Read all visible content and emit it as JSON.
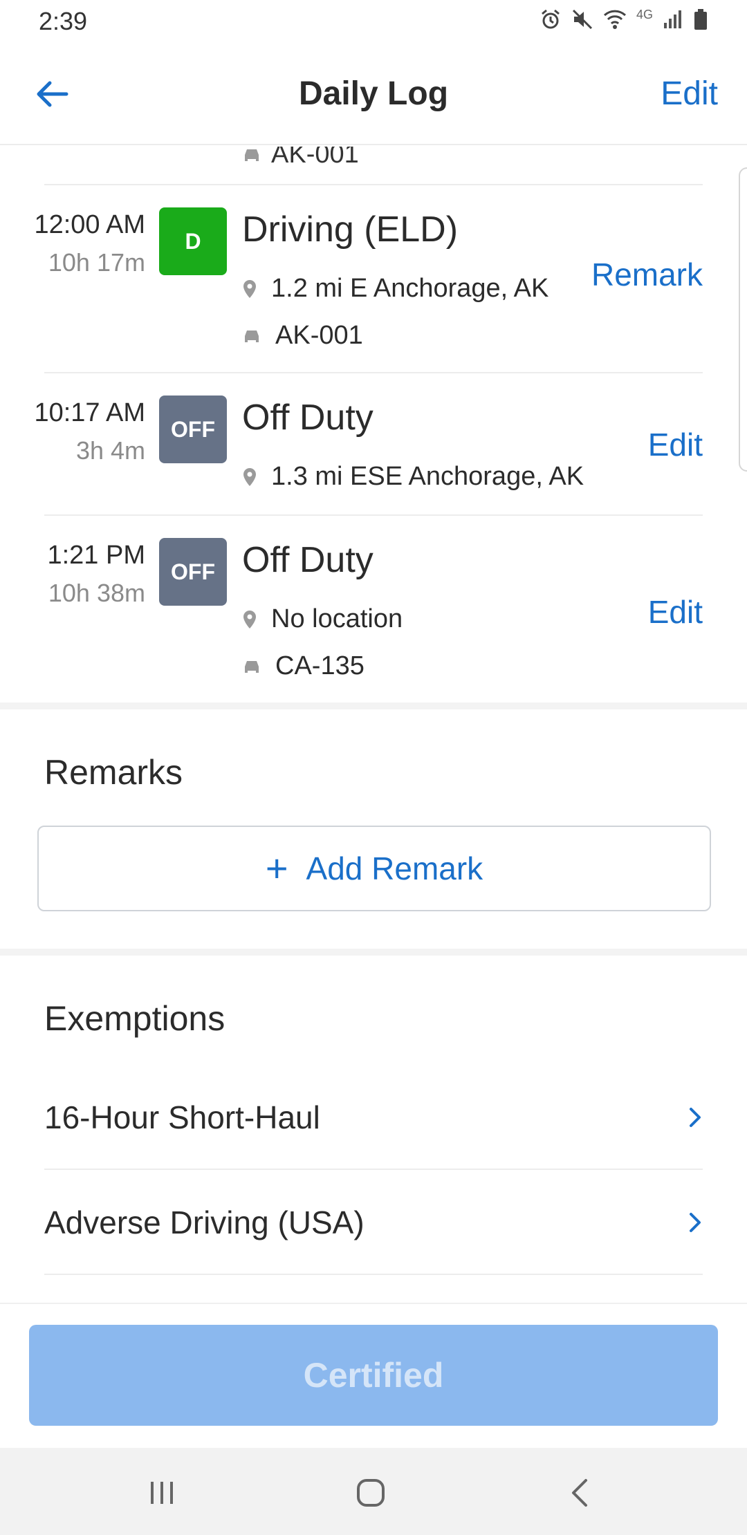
{
  "status_bar": {
    "time": "2:39",
    "network": "4G"
  },
  "header": {
    "title": "Daily Log",
    "edit_label": "Edit"
  },
  "clipped_row": {
    "vehicle": "AK-001"
  },
  "log_entries": [
    {
      "start_time": "12:00 AM",
      "duration": "10h 17m",
      "badge": "D",
      "status": "Driving (ELD)",
      "location": "1.2 mi E Anchorage, AK",
      "vehicle": "AK-001",
      "action": "Remark"
    },
    {
      "start_time": "10:17 AM",
      "duration": "3h 4m",
      "badge": "OFF",
      "status": "Off Duty",
      "location": "1.3 mi ESE Anchorage, AK",
      "action": "Edit"
    },
    {
      "start_time": "1:21 PM",
      "duration": "10h 38m",
      "badge": "OFF",
      "status": "Off Duty",
      "location": "No location",
      "vehicle": "CA-135",
      "action": "Edit"
    }
  ],
  "remarks": {
    "title": "Remarks",
    "add_label": "Add Remark"
  },
  "exemptions": {
    "title": "Exemptions",
    "items": [
      {
        "label": "16-Hour Short-Haul"
      },
      {
        "label": "Adverse Driving (USA)"
      }
    ]
  },
  "footer": {
    "certified_label": "Certified"
  },
  "colors": {
    "accent": "#1a6fc9",
    "driving": "#1aab1a",
    "off_duty": "#667287",
    "certified_bg": "#8bb8ee"
  },
  "icons": [
    "back-arrow-icon",
    "location-pin-icon",
    "car-icon",
    "plus-icon",
    "chevron-right-icon",
    "recent-apps-icon",
    "home-icon",
    "back-icon"
  ]
}
